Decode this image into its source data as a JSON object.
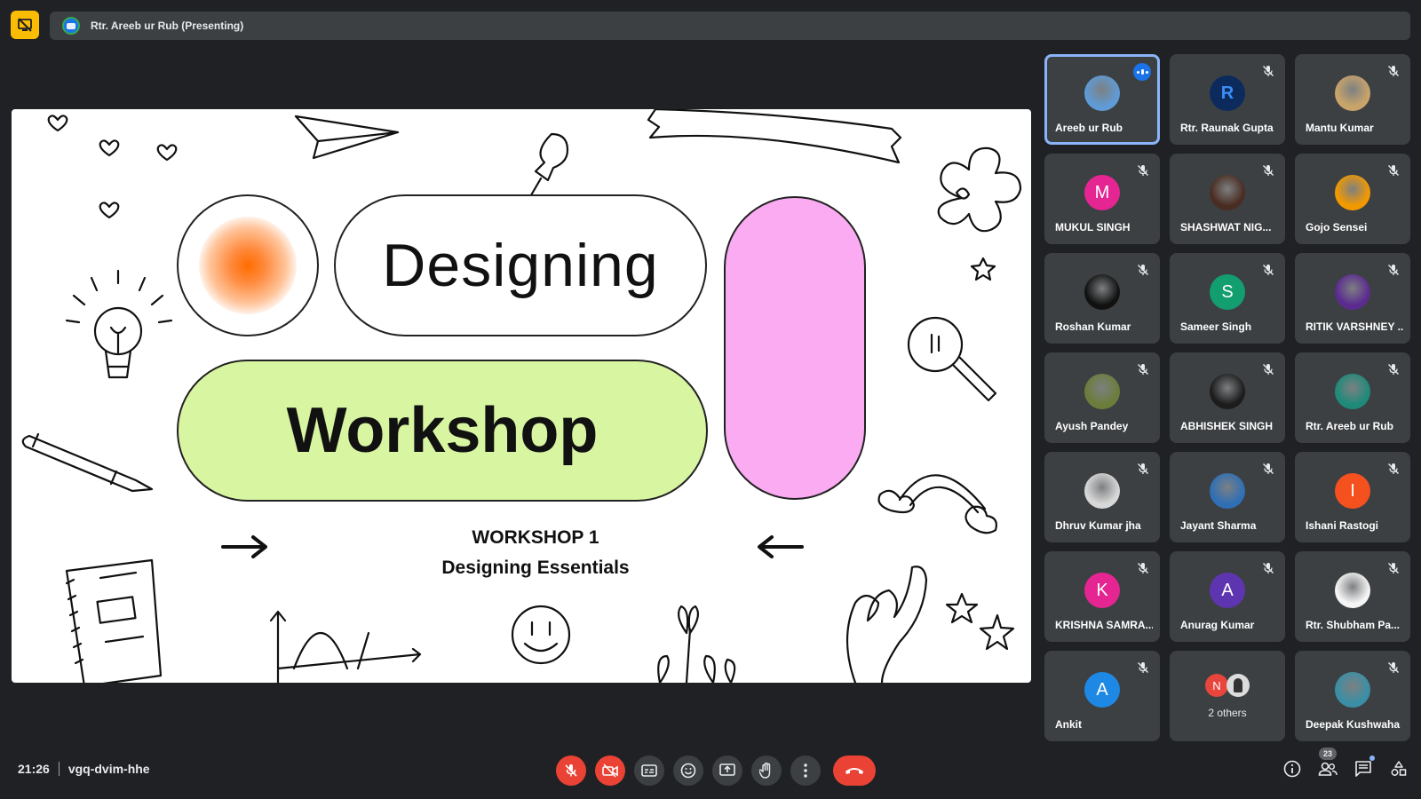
{
  "presentation_bar": {
    "presenter_text": "Rtr. Areeb ur Rub (Presenting)"
  },
  "slide": {
    "title_top": "Designing",
    "title_bottom": "Workshop",
    "subtitle_line1": "WORKSHOP 1",
    "subtitle_line2": "Designing Essentials"
  },
  "participants": [
    {
      "name": "Areeb ur Rub",
      "initial": "",
      "avatar": "laptop-photo",
      "color": "#5f9bd6",
      "speaking": true,
      "muted": false
    },
    {
      "name": "Rtr. Raunak Gupta",
      "initial": "R",
      "avatar": "logo-r",
      "color": "#0d2a5c",
      "speaking": false,
      "muted": true
    },
    {
      "name": "Mantu Kumar",
      "initial": "",
      "avatar": "emblem-photo",
      "color": "#c9a46a",
      "speaking": false,
      "muted": true
    },
    {
      "name": "MUKUL SINGH",
      "initial": "M",
      "avatar": "letter",
      "color": "#e52592",
      "speaking": false,
      "muted": true
    },
    {
      "name": "SHASHWAT NIG...",
      "initial": "",
      "avatar": "dark-photo",
      "color": "#4a2d22",
      "speaking": false,
      "muted": true
    },
    {
      "name": "Gojo Sensei",
      "initial": "",
      "avatar": "camera-photo",
      "color": "#f29900",
      "speaking": false,
      "muted": true
    },
    {
      "name": "Roshan Kumar",
      "initial": "",
      "avatar": "bw-photo",
      "color": "#111111",
      "speaking": false,
      "muted": true
    },
    {
      "name": "Sameer Singh",
      "initial": "S",
      "avatar": "letter",
      "color": "#129e6f",
      "speaking": false,
      "muted": true
    },
    {
      "name": "RITIK VARSHNEY ...",
      "initial": "",
      "avatar": "purple-photo",
      "color": "#5b2b8f",
      "speaking": false,
      "muted": true
    },
    {
      "name": "Ayush Pandey",
      "initial": "",
      "avatar": "outdoor-photo",
      "color": "#6b7d3a",
      "speaking": false,
      "muted": true
    },
    {
      "name": "ABHISHEK SINGH",
      "initial": "",
      "avatar": "portrait-photo",
      "color": "#1c1c1c",
      "speaking": false,
      "muted": true
    },
    {
      "name": "Rtr. Areeb ur Rub",
      "initial": "",
      "avatar": "laptop-photo-teal",
      "color": "#1f8a7a",
      "speaking": false,
      "muted": true
    },
    {
      "name": "Dhruv Kumar jha",
      "initial": "",
      "avatar": "face-photo",
      "color": "#d8d8d8",
      "speaking": false,
      "muted": true
    },
    {
      "name": "Jayant Sharma",
      "initial": "",
      "avatar": "sport-photo",
      "color": "#2f6fb5",
      "speaking": false,
      "muted": true
    },
    {
      "name": "Ishani Rastogi",
      "initial": "I",
      "avatar": "letter",
      "color": "#f4511e",
      "speaking": false,
      "muted": true
    },
    {
      "name": "KRISHNA SAMRA...",
      "initial": "K",
      "avatar": "letter",
      "color": "#e52592",
      "speaking": false,
      "muted": true
    },
    {
      "name": "Anurag Kumar",
      "initial": "A",
      "avatar": "letter",
      "color": "#5e35b1",
      "speaking": false,
      "muted": true
    },
    {
      "name": "Rtr. Shubham Pa...",
      "initial": "",
      "avatar": "club-logo",
      "color": "#f5f5f5",
      "speaking": false,
      "muted": true
    },
    {
      "name": "Ankit",
      "initial": "A",
      "avatar": "letter",
      "color": "#1e88e5",
      "speaking": false,
      "muted": true
    },
    {
      "name": "",
      "initial": "",
      "avatar": "others",
      "color": "#3c4043",
      "speaking": false,
      "muted": false
    },
    {
      "name": "Deepak Kushwaha",
      "initial": "",
      "avatar": "abstract-photo",
      "color": "#3a8fa6",
      "speaking": false,
      "muted": true
    }
  ],
  "others_tile": {
    "initial": "N",
    "label": "2 others"
  },
  "meeting": {
    "time": "21:26",
    "code": "vgq-dvim-hhe"
  },
  "controls": [
    {
      "icon": "mic-off-icon",
      "state": "off"
    },
    {
      "icon": "camera-off-icon",
      "state": "off"
    },
    {
      "icon": "captions-icon",
      "state": "normal"
    },
    {
      "icon": "emoji-icon",
      "state": "normal"
    },
    {
      "icon": "present-screen-icon",
      "state": "normal"
    },
    {
      "icon": "raise-hand-icon",
      "state": "normal"
    },
    {
      "icon": "more-options-icon",
      "state": "normal"
    },
    {
      "icon": "end-call-icon",
      "state": "end"
    }
  ],
  "right_panel": {
    "people_count": "23"
  },
  "colors": {
    "background": "#202124",
    "tile": "#3c4043",
    "active_border": "#8ab4f8",
    "danger": "#ea4335",
    "slide_green": "#d8f5a2",
    "slide_pink": "#fbabf2",
    "slide_orange": "#ff6d00"
  }
}
